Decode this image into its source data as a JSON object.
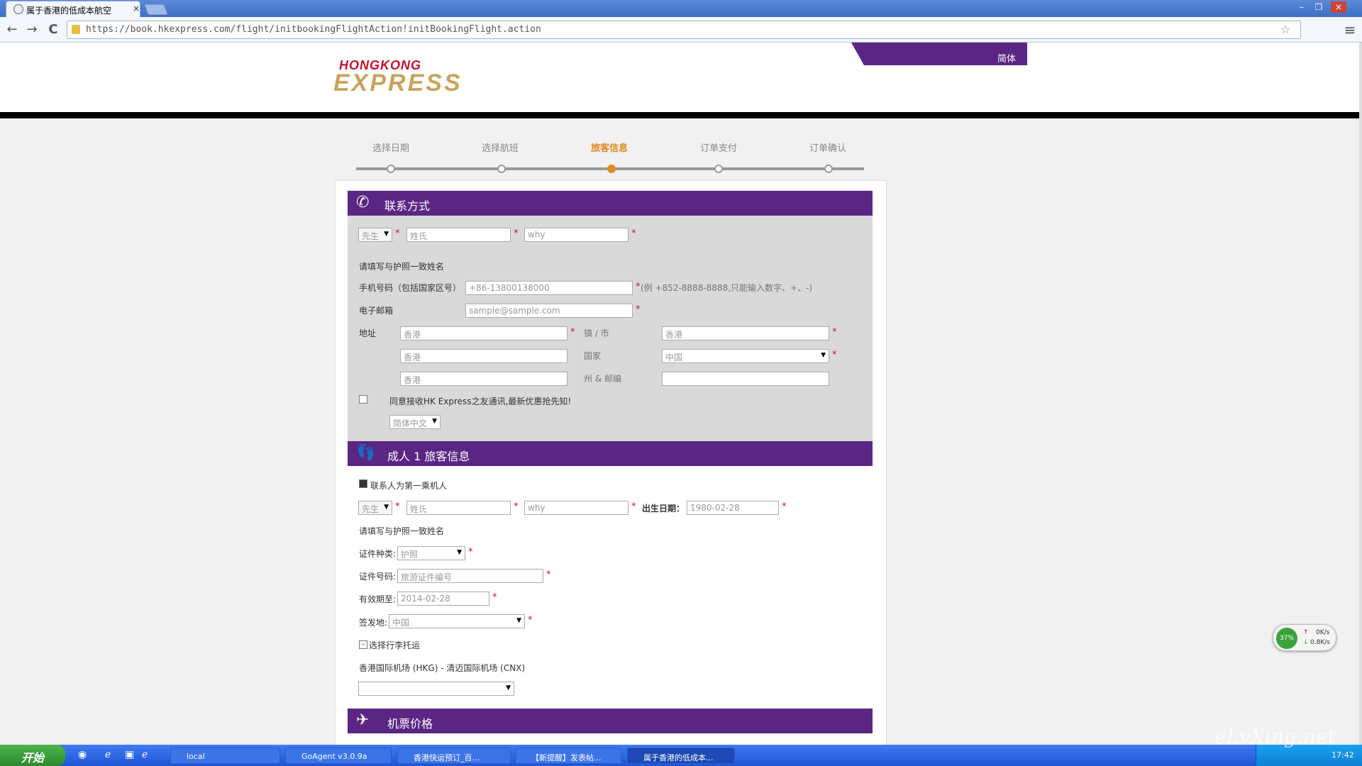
{
  "browser": {
    "tab_title": "属于香港的低成本航空",
    "tab_close": "×",
    "url": "https://book.hkexpress.com/flight/initbookingFlightAction!initBookingFlight.action",
    "win_min": "–",
    "win_max": "❐",
    "win_close": "×",
    "back": "←",
    "forward": "→",
    "reload": "C",
    "menu": "≡"
  },
  "header": {
    "logo_line1": "HONGKONG",
    "logo_line2": "EXPRESS",
    "language": "简体"
  },
  "steps": [
    {
      "label": "选择日期"
    },
    {
      "label": "选择航班"
    },
    {
      "label": "旅客信息"
    },
    {
      "label": "订单支付"
    },
    {
      "label": "订单确认"
    }
  ],
  "contact": {
    "title": "联系方式",
    "title_select": "先生",
    "surname_placeholder": "姓氏",
    "given_value": "why",
    "name_note": "请填写与护照一致姓名",
    "mobile_label": "手机号码（包括国家区号）",
    "mobile_value": "+86-13800138000",
    "mobile_hint": "(例 +852-8888-8888,只能输入数字、+、-)",
    "email_label": "电子邮箱",
    "email_placeholder": "sample@sample.com",
    "address_label": "地址",
    "addr1": "香港",
    "addr2": "香港",
    "addr3": "香港",
    "city_label": "镇 / 市",
    "city_value": "香港",
    "country_label": "国家",
    "country_value": "中国",
    "state_label": "州 & 邮编",
    "state_value": "",
    "newsletter_label": "同意接收HK Express之友通讯,最新优惠抢先知!",
    "lang_select": "简体中文"
  },
  "passenger": {
    "title": "成人 1 旅客信息",
    "same_as_contact": "联系人为第一乘机人",
    "title_select": "先生",
    "surname_placeholder": "姓氏",
    "given_value": "why",
    "dob_label": "出生日期：",
    "dob_value": "1980-02-28",
    "name_note": "请填写与护照一致姓名",
    "doc_type_label": "证件种类:",
    "doc_type_value": "护照",
    "doc_no_label": "证件号码:",
    "doc_no_placeholder": "旅游证件编号",
    "expiry_label": "有效期至:",
    "expiry_value": "2014-02-28",
    "issue_label": "签发地:",
    "issue_value": "中国",
    "baggage_label": "选择行李托运",
    "route": "香港国际机场 (HKG) - 清迈国际机场 (CNX)",
    "baggage_select": ""
  },
  "price": {
    "title": "机票价格"
  },
  "net_widget": {
    "percent": "37%",
    "up": "0K/s",
    "down": "0.8K/s"
  },
  "taskbar": {
    "start": "开始",
    "items": [
      {
        "label": "local"
      },
      {
        "label": "GoAgent v3.0.9a"
      },
      {
        "label": "香港快运预订_百..."
      },
      {
        "label": "【新提醒】发表帖..."
      },
      {
        "label": "属于香港的低成本..."
      }
    ],
    "clock": "17:42"
  },
  "watermark": "eLvXing.net",
  "colors": {
    "brand_purple": "#5b2583",
    "accent_orange": "#e08a1e",
    "logo_red": "#c8102e",
    "logo_gold": "#c9a45c"
  }
}
